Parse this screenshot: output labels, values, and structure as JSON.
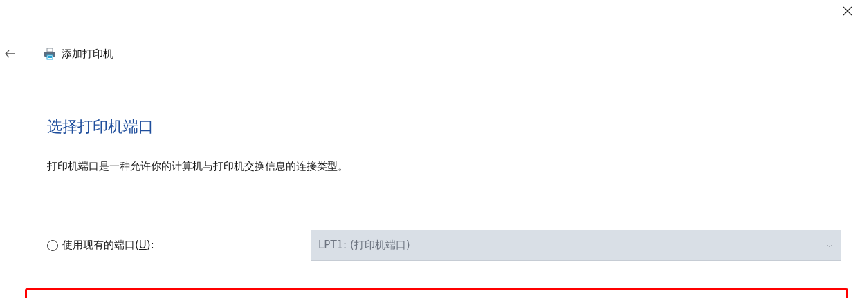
{
  "window": {
    "title": "添加打印机"
  },
  "heading": "选择打印机端口",
  "description": "打印机端口是一种允许你的计算机与打印机交换信息的连接类型。",
  "port_options": [
    {
      "label": "使用现有的端口(",
      "access_key": "U",
      "label_end": "):",
      "selected": false,
      "dropdown": {
        "value": "LPT1: (打印机端口)",
        "disabled": true
      }
    }
  ]
}
